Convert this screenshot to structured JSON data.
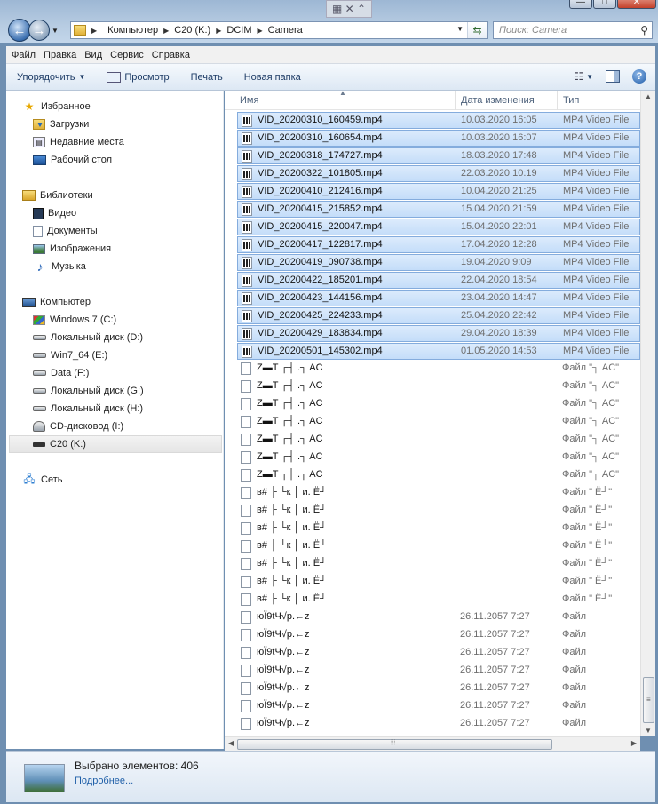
{
  "window": {
    "snap_icons": "▦ ✕ ⌃",
    "controls": {
      "minimize": "—",
      "maximize": "□",
      "close": "✕"
    }
  },
  "address": {
    "crumbs": [
      "Компьютер",
      "C20 (K:)",
      "DCIM",
      "Camera"
    ]
  },
  "search": {
    "placeholder": "Поиск: Camera"
  },
  "menu": [
    "Файл",
    "Правка",
    "Вид",
    "Сервис",
    "Справка"
  ],
  "toolbar": {
    "organize": "Упорядочить",
    "preview": "Просмотр",
    "print": "Печать",
    "new_folder": "Новая папка"
  },
  "nav": {
    "favorites": {
      "label": "Избранное",
      "items": [
        "Загрузки",
        "Недавние места",
        "Рабочий стол"
      ]
    },
    "libraries": {
      "label": "Библиотеки",
      "items": [
        "Видео",
        "Документы",
        "Изображения",
        "Музыка"
      ]
    },
    "computer": {
      "label": "Компьютер",
      "items": [
        "Windows 7 (C:)",
        "Локальный диск (D:)",
        "Win7_64 (E:)",
        "Data (F:)",
        "Локальный диск (G:)",
        "Локальный диск (H:)",
        "CD-дисковод (I:)",
        "C20 (K:)"
      ]
    },
    "network": {
      "label": "Сеть"
    }
  },
  "columns": {
    "name": "Имя",
    "date": "Дата изменения",
    "type": "Тип"
  },
  "rows": [
    {
      "name": "VID_20200310_160459.mp4",
      "date": "10.03.2020 16:05",
      "type": "MP4 Video File",
      "icon": "video-file",
      "selected": true
    },
    {
      "name": "VID_20200310_160654.mp4",
      "date": "10.03.2020 16:07",
      "type": "MP4 Video File",
      "icon": "video-file",
      "selected": true
    },
    {
      "name": "VID_20200318_174727.mp4",
      "date": "18.03.2020 17:48",
      "type": "MP4 Video File",
      "icon": "video-file",
      "selected": true
    },
    {
      "name": "VID_20200322_101805.mp4",
      "date": "22.03.2020 10:19",
      "type": "MP4 Video File",
      "icon": "video-file",
      "selected": true
    },
    {
      "name": "VID_20200410_212416.mp4",
      "date": "10.04.2020 21:25",
      "type": "MP4 Video File",
      "icon": "video-file",
      "selected": true
    },
    {
      "name": "VID_20200415_215852.mp4",
      "date": "15.04.2020 21:59",
      "type": "MP4 Video File",
      "icon": "video-file",
      "selected": true
    },
    {
      "name": "VID_20200415_220047.mp4",
      "date": "15.04.2020 22:01",
      "type": "MP4 Video File",
      "icon": "video-file",
      "selected": true
    },
    {
      "name": "VID_20200417_122817.mp4",
      "date": "17.04.2020 12:28",
      "type": "MP4 Video File",
      "icon": "video-file",
      "selected": true
    },
    {
      "name": "VID_20200419_090738.mp4",
      "date": "19.04.2020 9:09",
      "type": "MP4 Video File",
      "icon": "video-file",
      "selected": true
    },
    {
      "name": "VID_20200422_185201.mp4",
      "date": "22.04.2020 18:54",
      "type": "MP4 Video File",
      "icon": "video-file",
      "selected": true
    },
    {
      "name": "VID_20200423_144156.mp4",
      "date": "23.04.2020 14:47",
      "type": "MP4 Video File",
      "icon": "video-file",
      "selected": true
    },
    {
      "name": "VID_20200425_224233.mp4",
      "date": "25.04.2020 22:42",
      "type": "MP4 Video File",
      "icon": "video-file",
      "selected": true
    },
    {
      "name": "VID_20200429_183834.mp4",
      "date": "29.04.2020 18:39",
      "type": "MP4 Video File",
      "icon": "video-file",
      "selected": true
    },
    {
      "name": "VID_20200501_145302.mp4",
      "date": "01.05.2020 14:53",
      "type": "MP4 Video File",
      "icon": "video-file",
      "selected": true
    },
    {
      "name": "Z▬T ┌┤ .┐ AC",
      "date": "",
      "type": "Файл \"┐ AC\"",
      "icon": "blank-file",
      "selected": false
    },
    {
      "name": "Z▬T ┌┤ .┐ AC",
      "date": "",
      "type": "Файл \"┐ AC\"",
      "icon": "blank-file",
      "selected": false
    },
    {
      "name": "Z▬T ┌┤ .┐ AC",
      "date": "",
      "type": "Файл \"┐ AC\"",
      "icon": "blank-file",
      "selected": false
    },
    {
      "name": "Z▬T ┌┤ .┐ AC",
      "date": "",
      "type": "Файл \"┐ AC\"",
      "icon": "blank-file",
      "selected": false
    },
    {
      "name": "Z▬T ┌┤ .┐ AC",
      "date": "",
      "type": "Файл \"┐ AC\"",
      "icon": "blank-file",
      "selected": false
    },
    {
      "name": "Z▬T ┌┤ .┐ AC",
      "date": "",
      "type": "Файл \"┐ AC\"",
      "icon": "blank-file",
      "selected": false
    },
    {
      "name": "Z▬T ┌┤ .┐ AC",
      "date": "",
      "type": "Файл \"┐ AC\"",
      "icon": "blank-file",
      "selected": false
    },
    {
      "name": "в# ├ └к │ и. Ё┘",
      "date": "",
      "type": "Файл \" Ё┘\"",
      "icon": "blank-file",
      "selected": false
    },
    {
      "name": "в# ├ └к │ и. Ё┘",
      "date": "",
      "type": "Файл \" Ё┘\"",
      "icon": "blank-file",
      "selected": false
    },
    {
      "name": "в# ├ └к │ и. Ё┘",
      "date": "",
      "type": "Файл \" Ё┘\"",
      "icon": "blank-file",
      "selected": false
    },
    {
      "name": "в# ├ └к │ и. Ё┘",
      "date": "",
      "type": "Файл \" Ё┘\"",
      "icon": "blank-file",
      "selected": false
    },
    {
      "name": "в# ├ └к │ и. Ё┘",
      "date": "",
      "type": "Файл \" Ё┘\"",
      "icon": "blank-file",
      "selected": false
    },
    {
      "name": "в# ├ └к │ и. Ё┘",
      "date": "",
      "type": "Файл \" Ё┘\"",
      "icon": "blank-file",
      "selected": false
    },
    {
      "name": "в# ├ └к │ и. Ё┘",
      "date": "",
      "type": "Файл \" Ё┘\"",
      "icon": "blank-file",
      "selected": false
    },
    {
      "name": "юЇ9tЧ√р.←z",
      "date": "26.11.2057 7:27",
      "type": "Файл",
      "icon": "blank-file",
      "selected": false
    },
    {
      "name": "юЇ9tЧ√р.←z",
      "date": "26.11.2057 7:27",
      "type": "Файл",
      "icon": "blank-file",
      "selected": false
    },
    {
      "name": "юЇ9tЧ√р.←z",
      "date": "26.11.2057 7:27",
      "type": "Файл",
      "icon": "blank-file",
      "selected": false
    },
    {
      "name": "юЇ9tЧ√р.←z",
      "date": "26.11.2057 7:27",
      "type": "Файл",
      "icon": "blank-file",
      "selected": false
    },
    {
      "name": "юЇ9tЧ√р.←z",
      "date": "26.11.2057 7:27",
      "type": "Файл",
      "icon": "blank-file",
      "selected": false
    },
    {
      "name": "юЇ9tЧ√р.←z",
      "date": "26.11.2057 7:27",
      "type": "Файл",
      "icon": "blank-file",
      "selected": false
    },
    {
      "name": "юЇ9tЧ√р.←z",
      "date": "26.11.2057 7:27",
      "type": "Файл",
      "icon": "blank-file",
      "selected": false
    }
  ],
  "details": {
    "selected_text": "Выбрано элементов: 406",
    "more_link": "Подробнее..."
  },
  "colors": {
    "selection_bg": "#cfe3fb",
    "selection_border": "#84acdd",
    "link": "#1f5fa8"
  }
}
